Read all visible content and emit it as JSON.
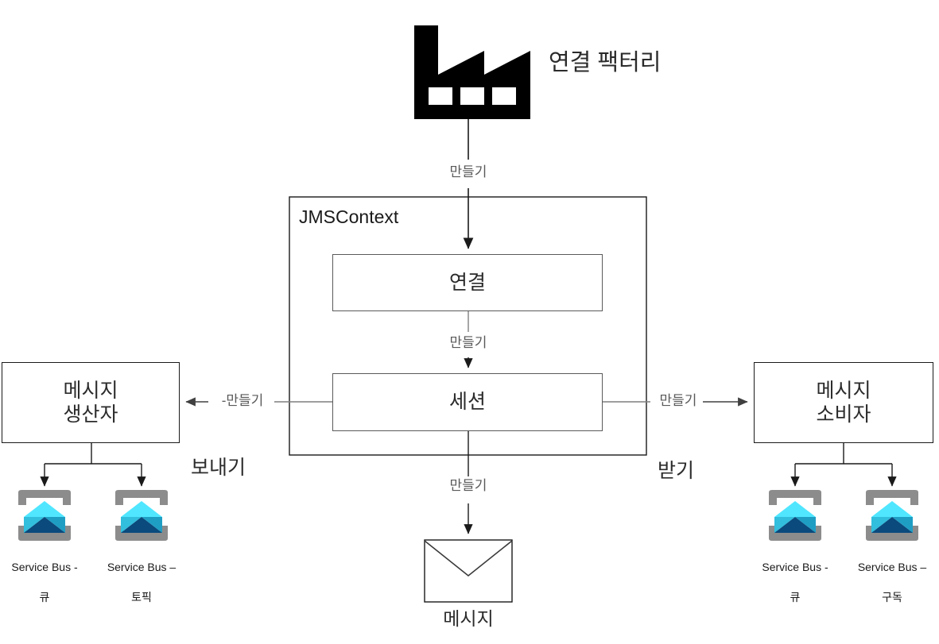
{
  "diagram": {
    "title": "연결 팩터리",
    "context_label": "JMSContext",
    "nodes": {
      "connection": "연결",
      "session": "세션",
      "producer": "메시지\n생산자",
      "consumer": "메시지\n소비자",
      "message": "메시지"
    },
    "edge_labels": {
      "factory_to_context": "만들기",
      "connection_to_session": "만들기",
      "session_to_producer": "-만들기",
      "session_to_consumer": "만들기",
      "session_to_message": "만들기",
      "producer_send": "보내기",
      "consumer_receive": "받기"
    },
    "icons": {
      "factory": "factory-icon",
      "envelope": "envelope-icon",
      "service_bus": "service-bus-icon"
    },
    "service_bus_items": [
      {
        "id": "producer-queue",
        "line1": "Service Bus -",
        "line2": "큐"
      },
      {
        "id": "producer-topic",
        "line1": "Service Bus –",
        "line2": "토픽"
      },
      {
        "id": "consumer-queue",
        "line1": "Service Bus -",
        "line2": "큐"
      },
      {
        "id": "consumer-subscription",
        "line1": "Service Bus –",
        "line2": "구독"
      }
    ],
    "colors": {
      "background": "#ffffff",
      "box_stroke": "#5a5a5a",
      "box_stroke_dark": "#1a1a1a",
      "edge_stroke_gray": "#7f7f7f",
      "edge_stroke_dark": "#1a1a1a",
      "text": "#2b2b2b",
      "edge_text": "#595959",
      "icon_bracket": "#8c8c8c",
      "icon_light": "#50e6ff",
      "icon_mid": "#32bedd",
      "icon_mid2": "#1f9ec4",
      "icon_dark": "#0a4a7c",
      "factory": "#000000"
    }
  }
}
